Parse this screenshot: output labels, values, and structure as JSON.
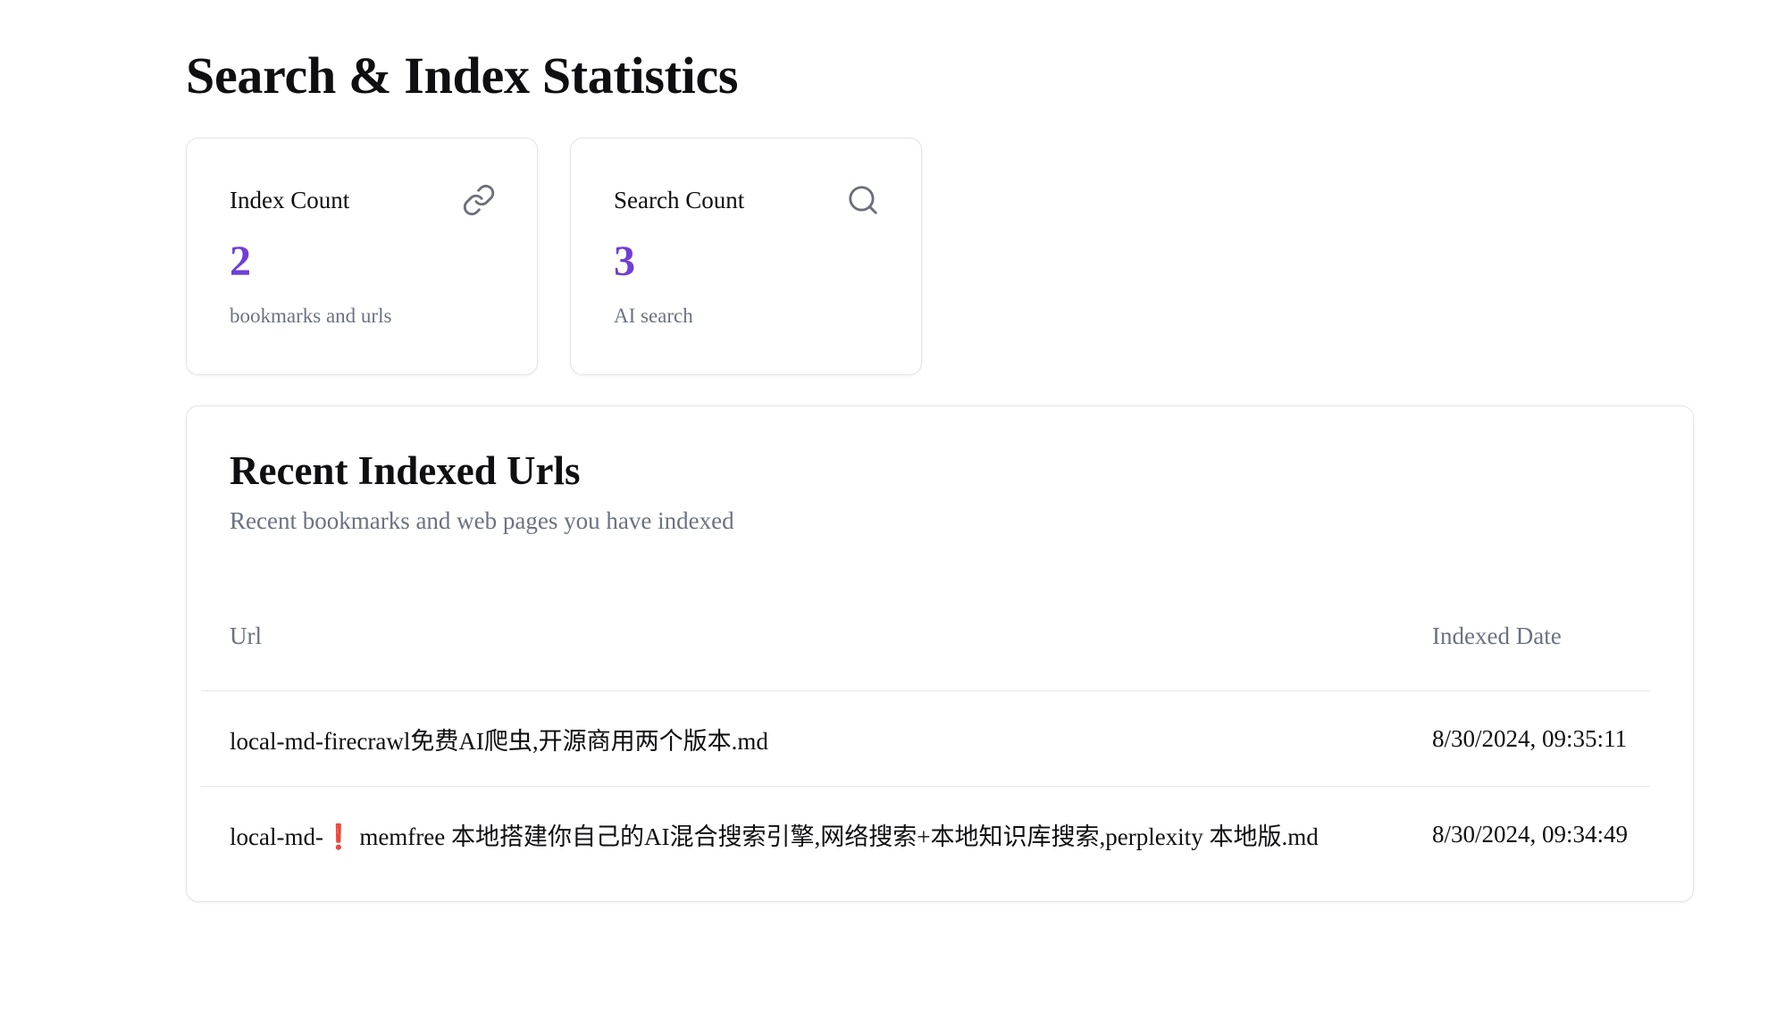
{
  "page": {
    "title": "Search & Index Statistics"
  },
  "stats": {
    "index": {
      "label": "Index Count",
      "value": "2",
      "caption": "bookmarks and urls",
      "icon": "link-icon"
    },
    "search": {
      "label": "Search Count",
      "value": "3",
      "caption": "AI search",
      "icon": "search-icon"
    },
    "accent_color": "#6f3fd8"
  },
  "recent": {
    "title": "Recent Indexed Urls",
    "subtitle": "Recent bookmarks and web pages you have indexed",
    "columns": {
      "url": "Url",
      "date": "Indexed Date"
    },
    "rows": [
      {
        "url": "local-md-firecrawl免费AI爬虫,开源商用两个版本.md",
        "date": "8/30/2024, 09:35:11"
      },
      {
        "url": "local-md-❗ memfree 本地搭建你自己的AI混合搜索引擎,网络搜索+本地知识库搜索,perplexity 本地版.md",
        "date": "8/30/2024, 09:34:49"
      }
    ]
  }
}
